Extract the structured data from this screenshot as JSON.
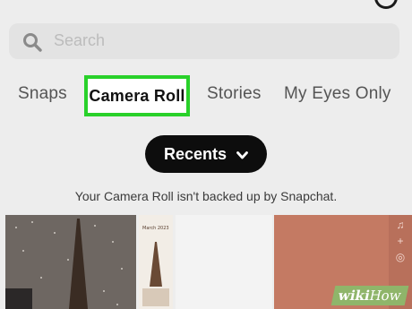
{
  "search": {
    "placeholder": "Search"
  },
  "tabs": [
    {
      "label": "Snaps"
    },
    {
      "label": "Camera Roll"
    },
    {
      "label": "Stories"
    },
    {
      "label": "My Eyes Only"
    }
  ],
  "recents": {
    "label": "Recents"
  },
  "notice": "Your Camera Roll isn't backed up by Snapchat.",
  "thumbnails": {
    "second_label": "March 2023"
  },
  "watermark": {
    "brand_left": "wiki",
    "brand_right": "How"
  },
  "colors": {
    "accent_highlight": "#29d12a",
    "background": "#ededed",
    "pill": "#0d0d0d"
  }
}
